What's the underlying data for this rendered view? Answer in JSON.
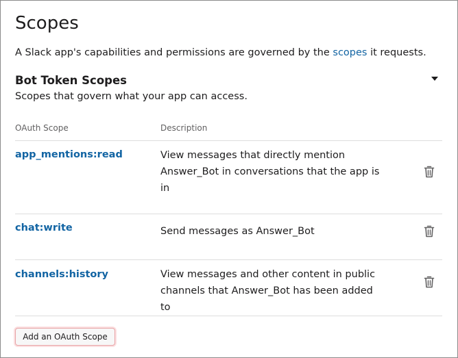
{
  "page": {
    "title": "Scopes",
    "intro_before": "A Slack app's capabilities and permissions are governed by the ",
    "intro_link": "scopes",
    "intro_after": " it requests."
  },
  "section": {
    "title": "Bot Token Scopes",
    "subtitle": "Scopes that govern what your app can access.",
    "col_scope": "OAuth Scope",
    "col_description": "Description"
  },
  "scopes": [
    {
      "name": "app_mentions:read",
      "description": "View messages that directly mention Answer_Bot in conversations that the app is in"
    },
    {
      "name": "chat:write",
      "description": "Send messages as Answer_Bot"
    },
    {
      "name": "channels:history",
      "description": "View messages and other content in public channels that Answer_Bot has been added to"
    }
  ],
  "add_button_label": "Add an OAuth Scope",
  "colors": {
    "link": "#1264a3",
    "text": "#1d1c1d",
    "muted": "#616061",
    "divider": "#dddddd",
    "button_highlight": "#e8a3a6"
  },
  "icons": {
    "collapse": "caret-down-icon",
    "remove": "trash-icon"
  }
}
